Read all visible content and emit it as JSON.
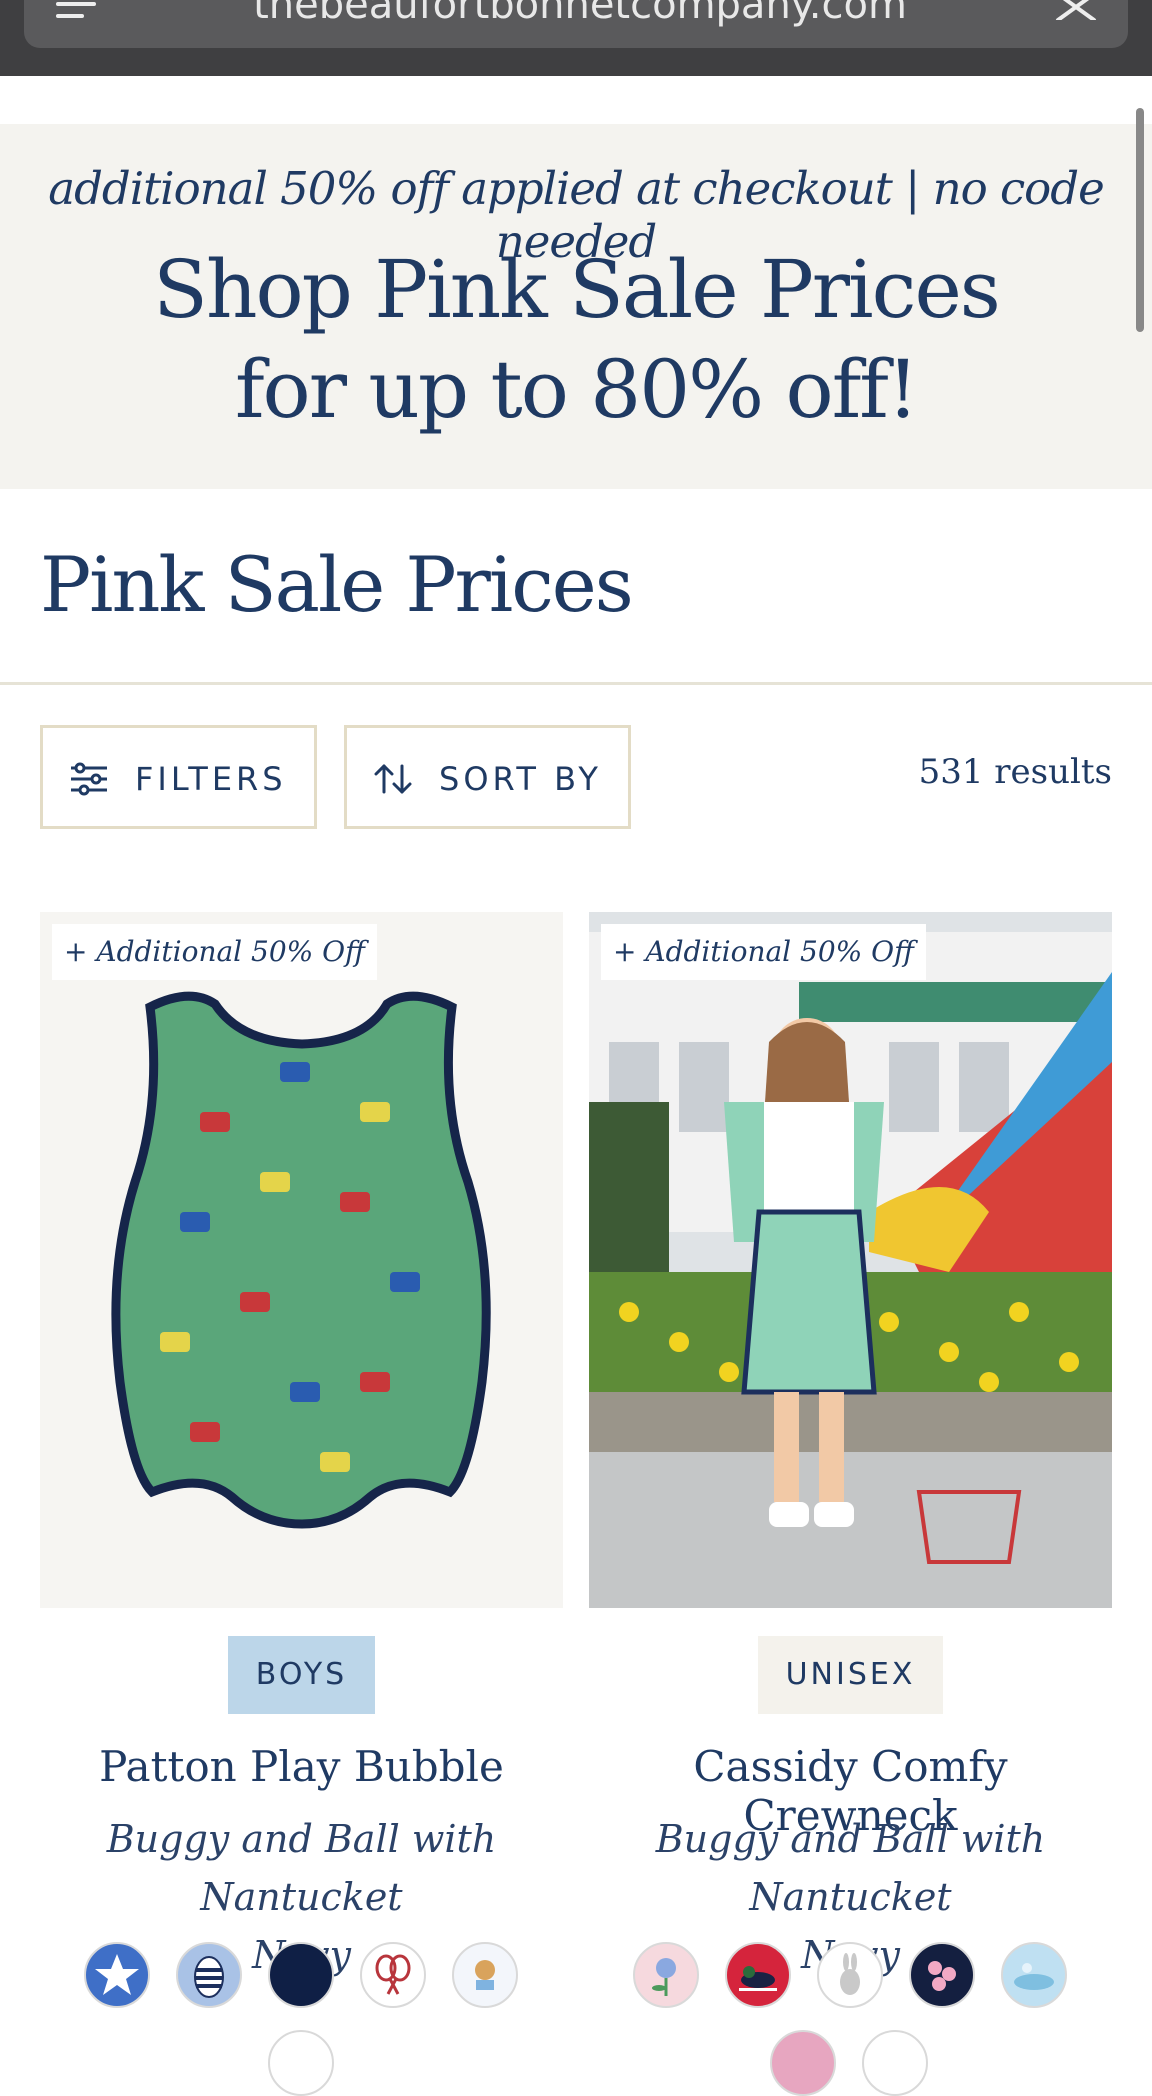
{
  "browser": {
    "url": "thebeaufortbonnetcompany.com"
  },
  "promo": {
    "subtitle": "additional 50% off applied at checkout | no code needed",
    "title_line1": "Shop Pink Sale Prices",
    "title_line2": "for up to 80% off!"
  },
  "page": {
    "title": "Pink Sale Prices"
  },
  "toolbar": {
    "filters_label": "FILTERS",
    "sort_label": "SORT BY",
    "results": "531 results"
  },
  "products": [
    {
      "tag": "+ Additional 50% Off",
      "badge": "BOYS",
      "name": "Patton Play Bubble",
      "color_line1": "Buggy and Ball with Nantucket",
      "color_line2": "Navy",
      "swatches": [
        "star-swatch",
        "bee-stripe-swatch",
        "navy-swatch",
        "tennis-racquet-swatch",
        "dog-print-swatch"
      ]
    },
    {
      "tag": "+ Additional 50% Off",
      "badge": "UNISEX",
      "name": "Cassidy Comfy Crewneck",
      "color_line1": "Buggy and Ball with Nantucket",
      "color_line2": "Navy",
      "swatches": [
        "floral-pink-swatch",
        "duck-red-swatch",
        "bunny-swatch",
        "blossom-navy-swatch",
        "watercolor-blue-swatch"
      ]
    }
  ],
  "colors": {
    "brand_navy": "#1f3a63",
    "promo_bg": "#f4f3ef",
    "boys_badge": "#bcd6e9",
    "unisex_badge": "#f4f2ec",
    "button_border": "#e3dcc6"
  }
}
